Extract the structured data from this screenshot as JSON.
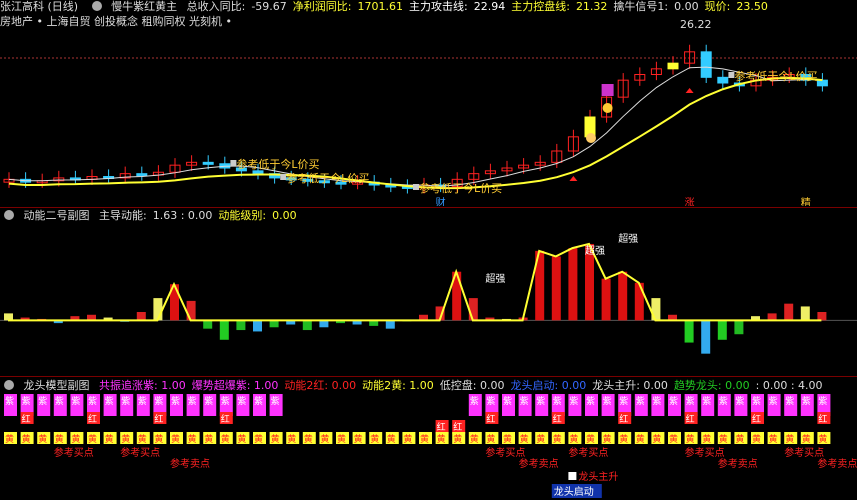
{
  "colors": {
    "yellow": "#ffff33",
    "red": "#ff2222",
    "cyan": "#33ccff",
    "green": "#22cc22",
    "magenta": "#ff33ff",
    "white": "#ffffff",
    "gold": "#ffcc33",
    "lime": "#99ff66"
  },
  "top": {
    "stock": "张江高科 (日线)",
    "indicator": "慢牛紫红黄主",
    "items": [
      {
        "label": "总收入同比:",
        "value": "-59.67",
        "color": "#dddddd"
      },
      {
        "label": "净利润同比:",
        "value": "1701.61",
        "color": "#ffff33"
      },
      {
        "label": "主力攻击线:",
        "value": "22.94",
        "color": "#ffffff"
      },
      {
        "label": "主力控盘线:",
        "value": "21.32",
        "color": "#ffff33"
      },
      {
        "label": "擒牛信号1:",
        "value": "0.00",
        "color": "#dddddd"
      },
      {
        "label": "现价:",
        "value": "23.50",
        "color": "#ffff33"
      }
    ],
    "sectors": "房地产 • 上海自贸 创投概念 租购同权 光刻机 •",
    "price_high": "26.22",
    "annotations": [
      "参考低于今L价买",
      "参考低于今L价买",
      "参考低于今L价买",
      "参考低于今L价买"
    ],
    "markers": [
      "财",
      "涨",
      "精"
    ]
  },
  "mid": {
    "title": "动能二号副图",
    "items": [
      {
        "label": "主导动能:",
        "value": "1.63 : 0.00",
        "color": "#dddddd"
      },
      {
        "label": "动能级别:",
        "value": "0.00",
        "color": "#ffff33"
      }
    ],
    "labels": [
      "超强",
      "超强",
      "超强"
    ]
  },
  "bot": {
    "title": "龙头模型副图",
    "items": [
      {
        "text": "共振追涨紫: 1.00",
        "color": "#ff33ff"
      },
      {
        "text": "爆势超爆紫: 1.00",
        "color": "#ff33ff"
      },
      {
        "text": "动能2红: 0.00",
        "color": "#ff2222"
      },
      {
        "text": "动能2黄: 1.00",
        "color": "#ffff33"
      },
      {
        "text": "低控盘: 0.00",
        "color": "#dddddd"
      },
      {
        "text": "龙头启动: 0.00",
        "color": "#3366ff"
      },
      {
        "text": "龙头主升: 0.00",
        "color": "#dddddd"
      },
      {
        "text": "趋势龙头: 0.00",
        "color": "#22cc22"
      },
      {
        "text": ": 0.00 : 4.00",
        "color": "#dddddd"
      }
    ],
    "purple_char": "紫",
    "red_char": "红",
    "yellow_char": "黄",
    "buy": "参考买点",
    "sell": "参考卖点",
    "dragon_up": "龙头主升",
    "dragon_start": "龙头启动"
  },
  "chart_data": {
    "type": "candlestick",
    "note_series": [
      "price",
      "momentum",
      "dragon-model"
    ],
    "close": [
      21.3,
      21.2,
      21.25,
      21.35,
      21.3,
      21.4,
      21.35,
      21.5,
      21.45,
      21.55,
      21.8,
      21.9,
      21.85,
      21.7,
      21.6,
      21.5,
      21.35,
      21.3,
      21.25,
      21.2,
      21.15,
      21.2,
      21.1,
      21.05,
      21.0,
      21.1,
      21.05,
      21.3,
      21.5,
      21.6,
      21.7,
      21.8,
      21.9,
      22.3,
      22.8,
      23.5,
      24.2,
      24.8,
      25.0,
      25.2,
      25.4,
      25.8,
      24.9,
      24.7,
      24.6,
      24.8,
      24.9,
      25.0,
      24.8,
      24.6
    ],
    "momentum": [
      0.5,
      0.2,
      0.1,
      -0.2,
      0.3,
      0.4,
      0.2,
      -0.1,
      0.6,
      1.6,
      2.6,
      1.4,
      -0.6,
      -1.4,
      -0.7,
      -0.8,
      -0.5,
      -0.3,
      -0.7,
      -0.5,
      -0.2,
      -0.3,
      -0.4,
      -0.6,
      0.0,
      0.4,
      1.0,
      3.5,
      1.6,
      0.2,
      0.1,
      0.2,
      5.0,
      4.6,
      5.2,
      5.5,
      3.0,
      3.5,
      2.7,
      1.6,
      0.4,
      -1.6,
      -2.4,
      -1.4,
      -1.0,
      0.3,
      0.5,
      1.2,
      1.0,
      0.6
    ],
    "ylim_price": [
      20.5,
      26.5
    ],
    "ylim_momentum": [
      -3,
      6
    ]
  }
}
